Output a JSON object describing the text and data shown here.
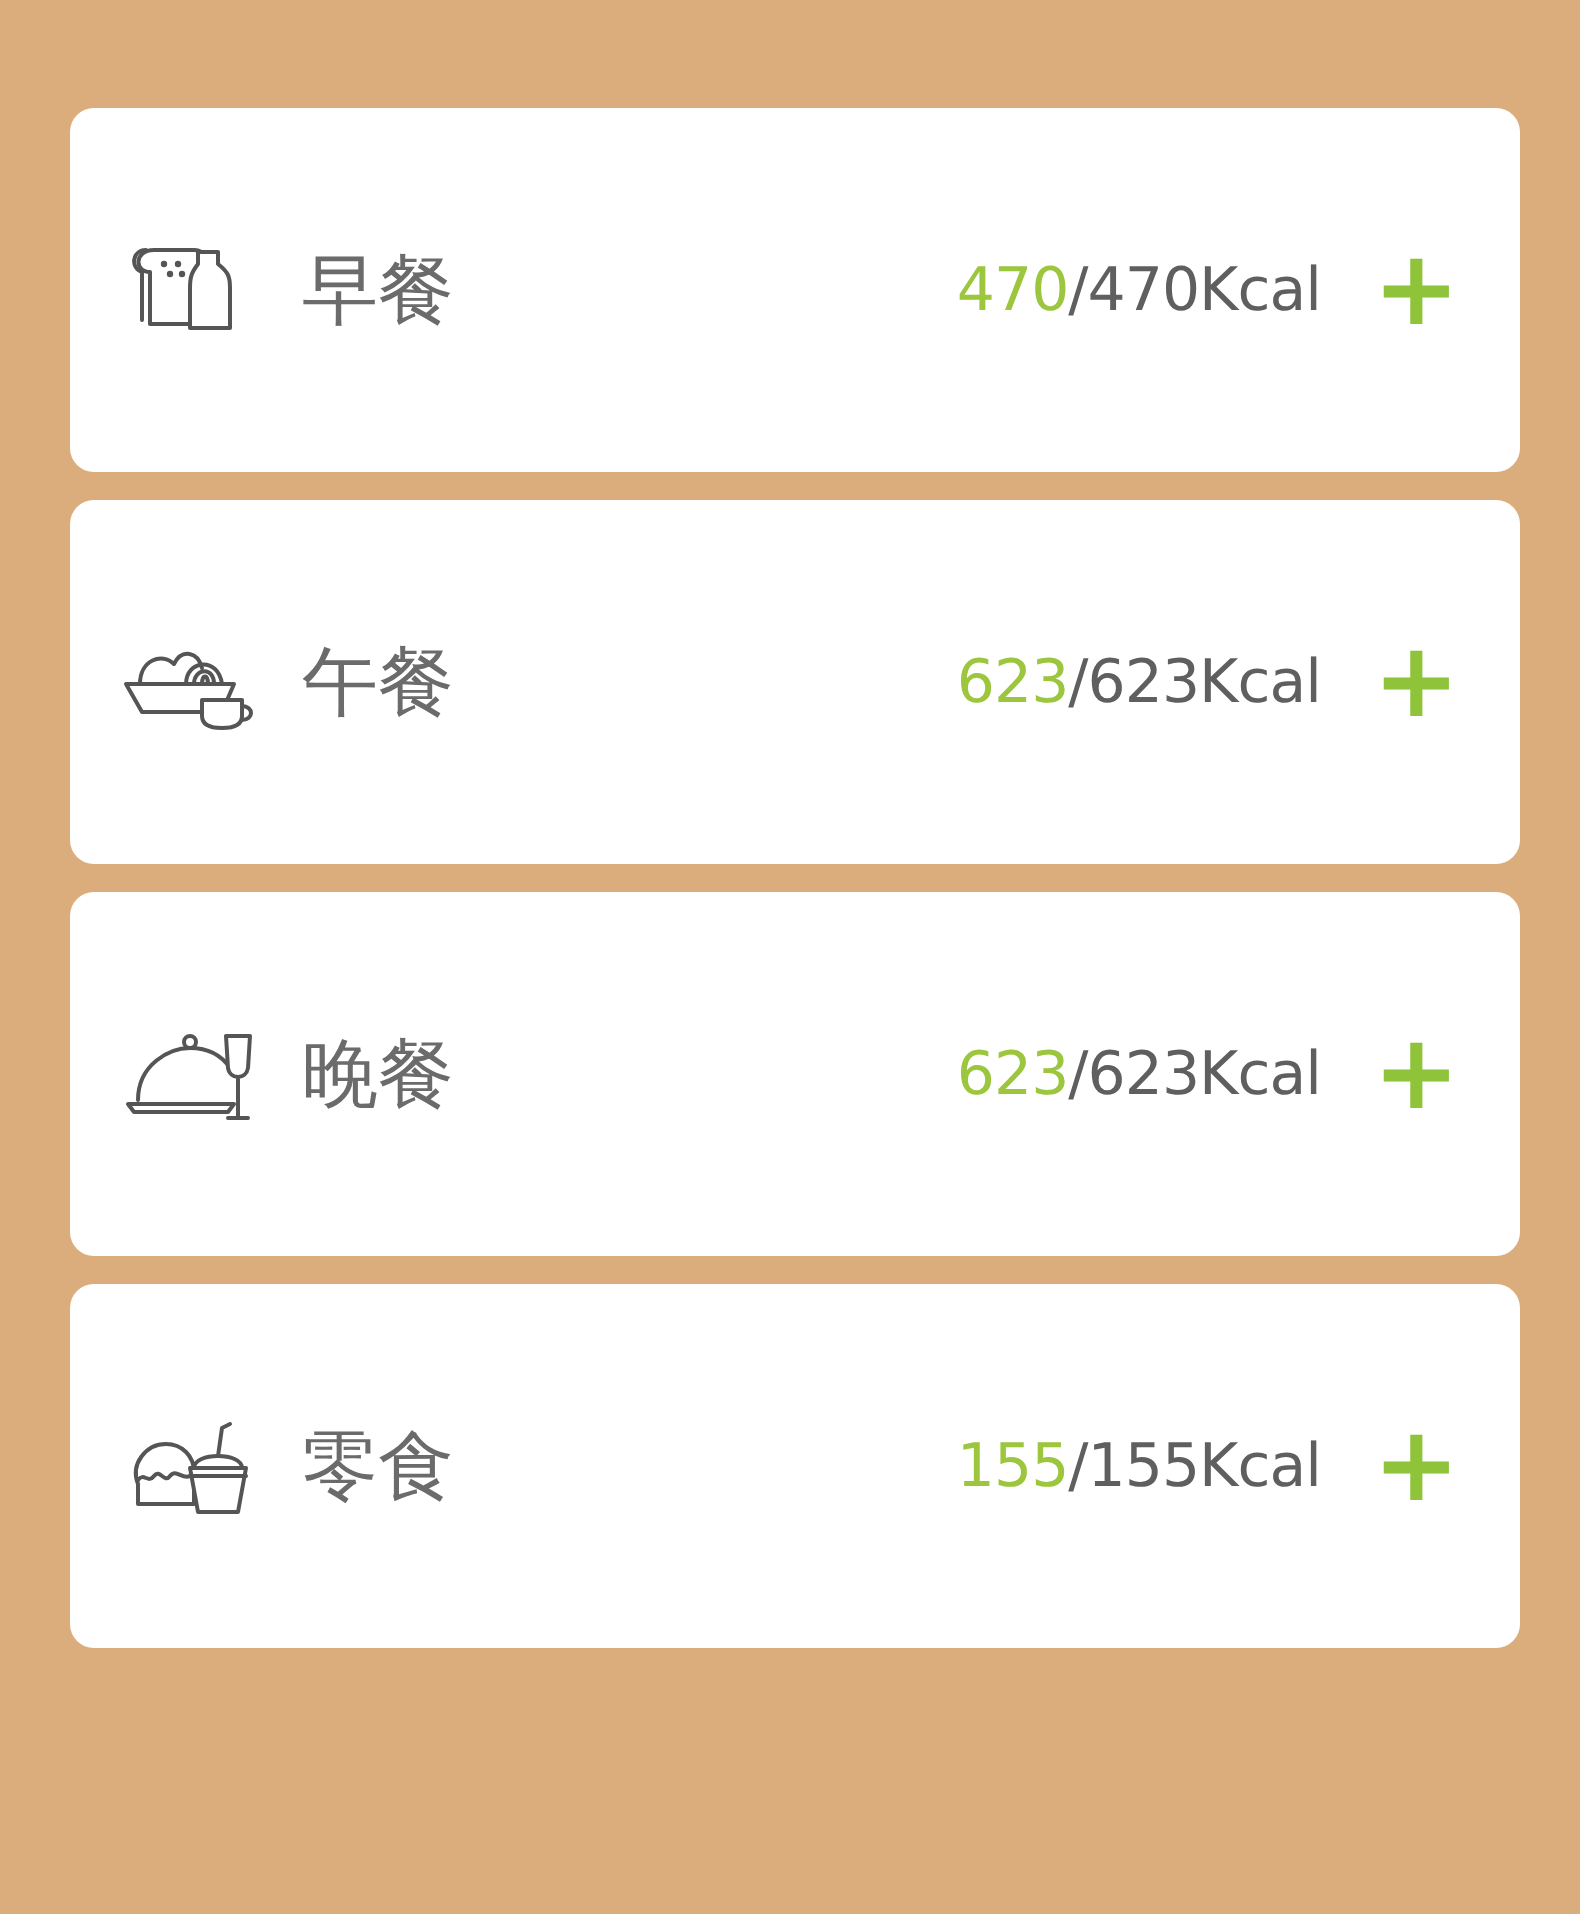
{
  "meals": [
    {
      "kind": "breakfast",
      "name": "早餐",
      "eaten": "470",
      "total": "/470Kcal",
      "add": "+"
    },
    {
      "kind": "lunch",
      "name": "午餐",
      "eaten": "623",
      "total": "/623Kcal",
      "add": "+"
    },
    {
      "kind": "dinner",
      "name": "晚餐",
      "eaten": "623",
      "total": "/623Kcal",
      "add": "+"
    },
    {
      "kind": "snack",
      "name": "零食",
      "eaten": "155",
      "total": "/155Kcal",
      "add": "+"
    }
  ]
}
